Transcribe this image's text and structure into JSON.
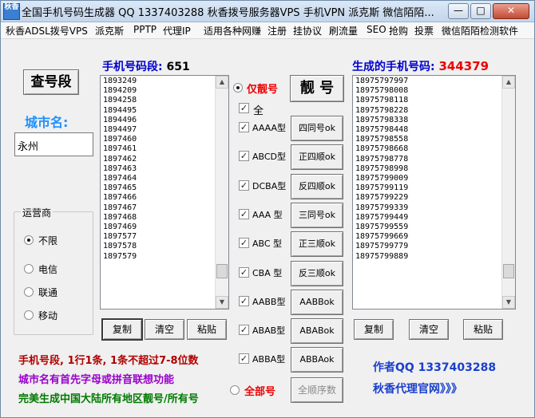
{
  "window": {
    "icon_text": "秋香",
    "title": "全国手机号码生成器 QQ 1337403288 秋香拨号服务器VPS 手机VPN 派克斯 微信陌陌..."
  },
  "menu": [
    "秋香ADSL拨号VPS",
    "派克斯",
    "PPTP",
    "代理IP",
    "适用各种网赚",
    "注册",
    "挂协议",
    "刷流量",
    "SEO",
    "抢购",
    "投票",
    "微信陌陌检测软件"
  ],
  "left": {
    "query_button": "查号段",
    "city_label": "城市名:",
    "city_value": "永州",
    "carrier_group": "运营商",
    "carriers": [
      {
        "label": "不限",
        "checked": true
      },
      {
        "label": "电信",
        "checked": false
      },
      {
        "label": "联通",
        "checked": false
      },
      {
        "label": "移动",
        "checked": false
      }
    ]
  },
  "segments": {
    "title_prefix": "手机号码段:",
    "count": "651",
    "list": [
      "1893249",
      "1894209",
      "1894258",
      "1894495",
      "1894496",
      "1894497",
      "1897460",
      "1897461",
      "1897462",
      "1897463",
      "1897464",
      "1897465",
      "1897466",
      "1897467",
      "1897468",
      "1897469",
      "1897577",
      "1897578",
      "1897579"
    ],
    "copy": "复制",
    "clear": "清空",
    "paste": "粘贴"
  },
  "options": {
    "only_pretty_label": "仅靓号",
    "pretty_button": "靓 号",
    "all_label": "全",
    "patterns": [
      {
        "label": "AAAA型",
        "button": "四同号ok"
      },
      {
        "label": "ABCD型",
        "button": "正四顺ok"
      },
      {
        "label": "DCBA型",
        "button": "反四顺ok"
      },
      {
        "label": "AAA 型",
        "button": "三同号ok"
      },
      {
        "label": "ABC 型",
        "button": "正三顺ok"
      },
      {
        "label": "CBA 型",
        "button": "反三顺ok"
      },
      {
        "label": "AABB型",
        "button": "AABBok"
      },
      {
        "label": "ABAB型",
        "button": "ABABok"
      },
      {
        "label": "ABBA型",
        "button": "ABBAok"
      }
    ],
    "all_numbers_label": "全部号",
    "all_sequence_button": "全顺序数"
  },
  "generated": {
    "title_prefix": "生成的手机号码:",
    "count": "344379",
    "list": [
      "18975797997",
      "18975798008",
      "18975798118",
      "18975798228",
      "18975798338",
      "18975798448",
      "18975798558",
      "18975798668",
      "18975798778",
      "18975798998",
      "18975799009",
      "18975799119",
      "18975799229",
      "18975799339",
      "18975799449",
      "18975799559",
      "18975799669",
      "18975799779",
      "18975799889"
    ],
    "copy": "复制",
    "clear": "清空",
    "paste": "粘贴"
  },
  "notes": {
    "line1": "手机号段, 1行1条, 1条不超过7-8位数",
    "line2": "城市名有首先字母或拼音联想功能",
    "line3": "完美生成中国大陆所有地区靓号/所有号"
  },
  "author": {
    "qq": "作者QQ 1337403288",
    "site": "秋香代理官网》》》"
  },
  "colors": {
    "title_blue": "#0000cc",
    "count_red": "#ee0000",
    "city_blue": "#1e90ff",
    "note_red": "#b00000",
    "note_purple": "#9900cc",
    "note_green": "#007a00",
    "author_blue": "#1a3fcc"
  }
}
